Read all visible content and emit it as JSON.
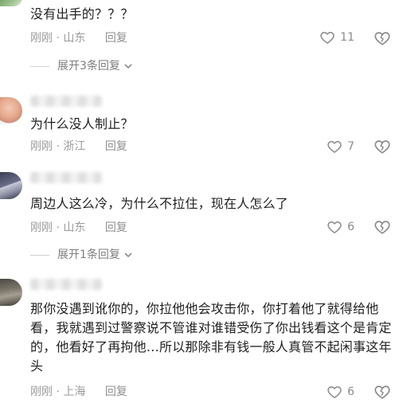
{
  "comments": [
    {
      "text": "没有出手的？？？",
      "time": "刚刚",
      "location": "山东",
      "reply_label": "回复",
      "likes": "11",
      "expand_label": "展开3条回复"
    },
    {
      "text": "为什么没人制止？",
      "time": "刚刚",
      "location": "浙江",
      "reply_label": "回复",
      "likes": "7"
    },
    {
      "text": "周边人这么冷，为什么不拉住，现在人怎么了",
      "time": "刚刚",
      "location": "山东",
      "reply_label": "回复",
      "likes": "6",
      "expand_label": "展开1条回复"
    },
    {
      "text": "那你没遇到讹你的，你拉他他会攻击你，你打着他了就得给他看，我就遇到过警察说不管谁对谁错受伤了你出钱看这个是肯定的，他看好了再拘他…所以那除非有钱一般人真管不起闲事这年头",
      "time": "刚刚",
      "location": "上海",
      "reply_label": "回复",
      "likes": "6"
    }
  ],
  "meta_separator": " · ",
  "icons": {
    "like": "heart-outline-icon",
    "dislike": "broken-heart-icon",
    "expand": "chevron-down-icon"
  },
  "colors": {
    "text": "#1f1f1f",
    "meta": "#9a9a9a",
    "icon": "#8a8a8a",
    "background": "#ffffff"
  }
}
